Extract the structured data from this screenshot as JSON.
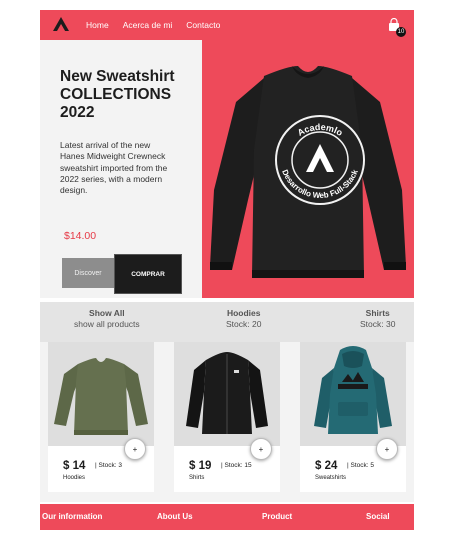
{
  "nav": {
    "links": [
      "Home",
      "Acerca de mi",
      "Contacto"
    ],
    "cart_count": "10"
  },
  "hero": {
    "title": "New Sweatshirt\nCOLLECTIONS\n2022",
    "description": "Latest arrival of the new Hanes Midweight Crewneck sweatshirt imported from the 2022 series, with a modern design.",
    "price": "$14.00",
    "discover_label": "Discover",
    "buy_label": "COMPRAR",
    "print_top": "Academlo",
    "print_bottom": "Desarrollo Web Full-Stack"
  },
  "categories": [
    {
      "title": "Show All",
      "subtitle": "show all products"
    },
    {
      "title": "Hoodies",
      "subtitle": "Stock: 20"
    },
    {
      "title": "Shirts",
      "subtitle": "Stock: 30"
    }
  ],
  "products": [
    {
      "price": "$ 14",
      "stock": "| Stock: 3",
      "category": "Hoodies",
      "add": "+"
    },
    {
      "price": "$ 19",
      "stock": "| Stock: 15",
      "category": "Shirts",
      "add": "+"
    },
    {
      "price": "$ 24",
      "stock": "| Stock: 5",
      "category": "Sweatshirts",
      "add": "+"
    }
  ],
  "footer": [
    "Our information",
    "About Us",
    "Product",
    "Social"
  ],
  "colors": {
    "accent": "#ee4a5a",
    "price": "#e63946",
    "dark": "#1c1c1c"
  }
}
